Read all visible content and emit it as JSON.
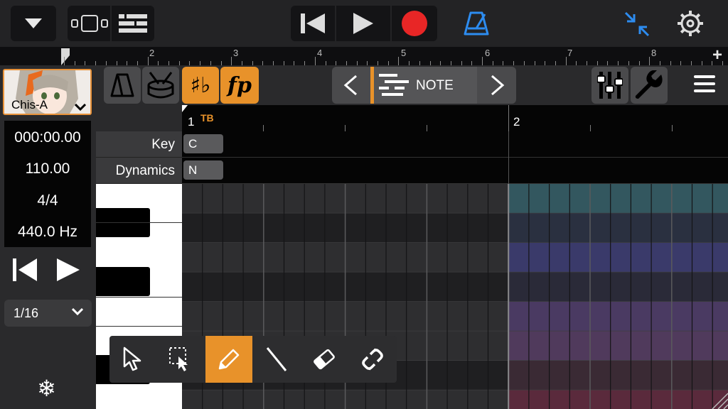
{
  "transport": {
    "icons": [
      "chevron-down-icon",
      "track-view-icon",
      "list-view-icon",
      "rewind-to-start-icon",
      "play-icon",
      "record-icon",
      "metronome-icon",
      "collapse-icon",
      "settings-gear-icon"
    ]
  },
  "ruler": {
    "bars": [
      "2",
      "3",
      "4",
      "5",
      "6",
      "7",
      "8"
    ],
    "add_label": "+"
  },
  "singer": {
    "name": "Chis-A"
  },
  "info": {
    "time": "000:00.00",
    "tempo": "110.00",
    "time_signature": "4/4",
    "tuning": "440.0 Hz"
  },
  "quantize": {
    "value": "1/16"
  },
  "toolbar": {
    "accidental_label": "♯♭",
    "dynamics_label": "fp",
    "mode_label": "NOTE"
  },
  "editor": {
    "bar_numbers": [
      "1",
      "2"
    ],
    "marker_label": "TB",
    "lanes": [
      {
        "name": "Key",
        "value": "C"
      },
      {
        "name": "Dynamics",
        "value": "N"
      }
    ]
  },
  "tools": {
    "items": [
      "arrow-tool-icon",
      "select-tool-icon",
      "pencil-tool-icon",
      "line-tool-icon",
      "eraser-tool-icon",
      "link-tool-icon"
    ],
    "active": "pencil-tool-icon"
  },
  "colors": {
    "accent_orange": "#e8922a",
    "record_red": "#e82626",
    "metronome_blue": "#2d8cf0",
    "panel": "#2a2a2c"
  }
}
